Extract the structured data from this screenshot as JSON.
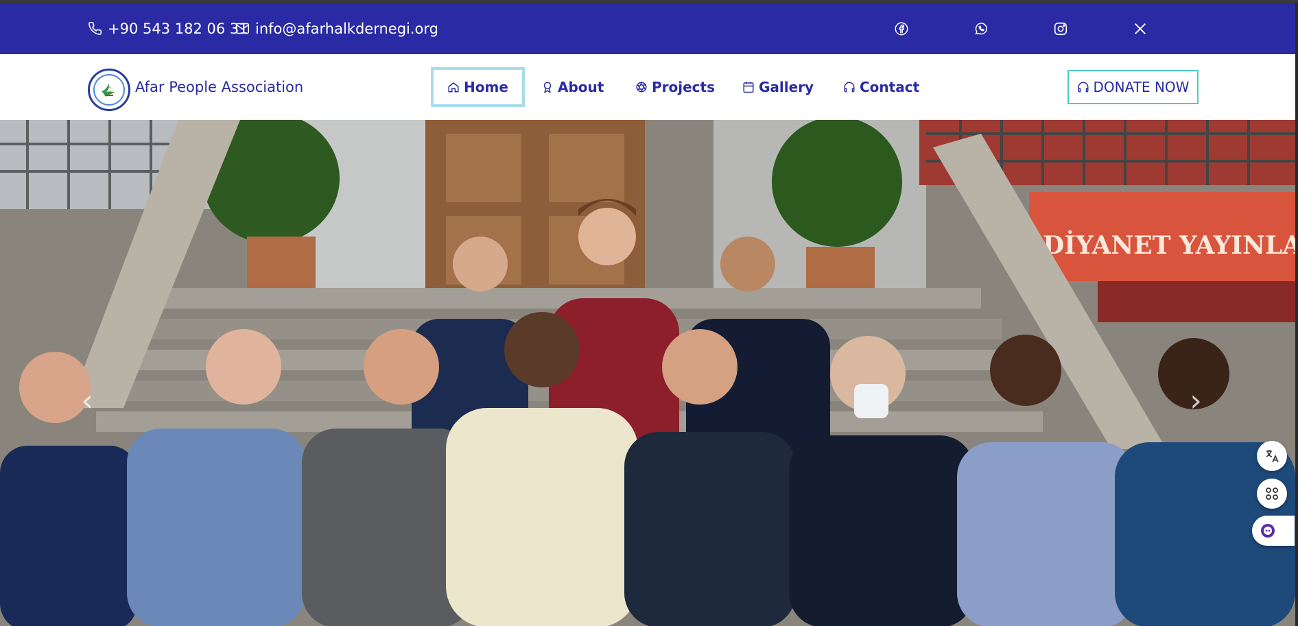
{
  "topbar": {
    "phone": "+90 543 182 06 31",
    "email": "info@afarhalkdernegi.org",
    "social": [
      "facebook-icon",
      "whatsapp-icon",
      "instagram-icon",
      "x-icon"
    ]
  },
  "brand": {
    "name": "Afar People Association",
    "logo_icon": "association-logo"
  },
  "nav": {
    "items": [
      {
        "label": "Home",
        "icon": "home-icon",
        "active": true
      },
      {
        "label": "About",
        "icon": "award-icon",
        "active": false
      },
      {
        "label": "Projects",
        "icon": "aperture-icon",
        "active": false
      },
      {
        "label": "Gallery",
        "icon": "calendar-icon",
        "active": false
      },
      {
        "label": "Contact",
        "icon": "headphones-icon",
        "active": false
      }
    ],
    "donate_label": "DONATE NOW"
  },
  "hero": {
    "sign_text": "DİYANET YAYINLAR",
    "prev_icon": "chevron-left-icon",
    "next_icon": "chevron-right-icon"
  },
  "floating": [
    "translate-icon",
    "apps-icon",
    "assistant-icon"
  ],
  "colors": {
    "primary": "#2a2aa4",
    "accent_border": "#a8dcec",
    "donate_border": "#4ecbc3"
  }
}
